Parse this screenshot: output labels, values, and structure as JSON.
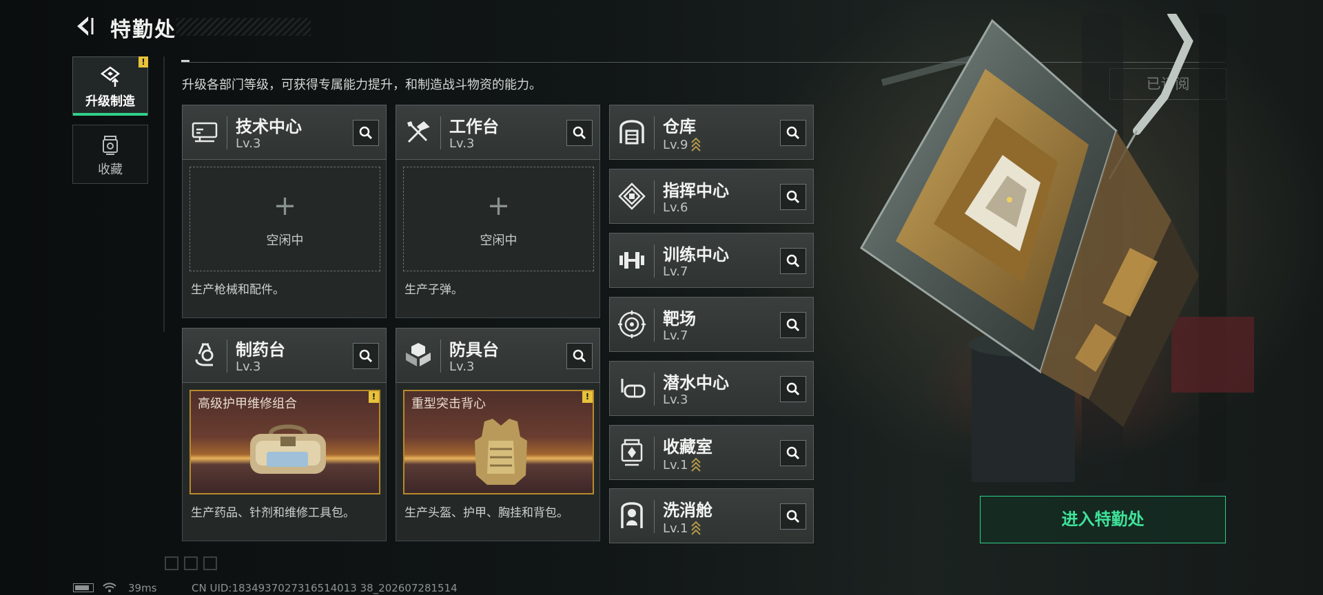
{
  "header": {
    "title": "特勤处",
    "back_icon": "back-arrow-icon"
  },
  "sidebar": {
    "tabs": [
      {
        "label": "升级制造",
        "icon": "upgrade-craft-icon",
        "active": true,
        "alert": "!"
      },
      {
        "label": "收藏",
        "icon": "collection-icon",
        "active": false
      }
    ]
  },
  "description": "升级各部门等级，可获得专属能力提升，和制造战斗物资的能力。",
  "subscribed_label": "已订阅",
  "stations": [
    {
      "name": "技术中心",
      "level": "Lv.3",
      "icon": "tech-center-icon",
      "slot": {
        "type": "idle",
        "plus": "+",
        "text": "空闲中"
      },
      "desc": "生产枪械和配件。"
    },
    {
      "name": "工作台",
      "level": "Lv.3",
      "icon": "workbench-icon",
      "slot": {
        "type": "idle",
        "plus": "+",
        "text": "空闲中"
      },
      "desc": "生产子弹。"
    },
    {
      "name": "制药台",
      "level": "Lv.3",
      "icon": "pharmacy-icon",
      "slot": {
        "type": "item",
        "item_name": "高级护甲维修组合",
        "alert": "!"
      },
      "desc": "生产药品、针剂和维修工具包。"
    },
    {
      "name": "防具台",
      "level": "Lv.3",
      "icon": "armor-bench-icon",
      "slot": {
        "type": "item",
        "item_name": "重型突击背心",
        "alert": "!"
      },
      "desc": "生产头盔、护甲、胸挂和背包。"
    }
  ],
  "side_stations": [
    {
      "name": "仓库",
      "level": "Lv.9",
      "upgradable": true,
      "icon": "warehouse-icon"
    },
    {
      "name": "指挥中心",
      "level": "Lv.6",
      "upgradable": false,
      "icon": "command-center-icon"
    },
    {
      "name": "训练中心",
      "level": "Lv.7",
      "upgradable": false,
      "icon": "training-center-icon"
    },
    {
      "name": "靶场",
      "level": "Lv.7",
      "upgradable": false,
      "icon": "shooting-range-icon"
    },
    {
      "name": "潜水中心",
      "level": "Lv.3",
      "upgradable": false,
      "icon": "diving-center-icon"
    },
    {
      "name": "收藏室",
      "level": "Lv.1",
      "upgradable": true,
      "icon": "collection-room-icon"
    },
    {
      "name": "洗消舱",
      "level": "Lv.1",
      "upgradable": true,
      "icon": "decon-chamber-icon"
    }
  ],
  "enter_button": "进入特勤处",
  "status": {
    "ping": "39ms",
    "uid": "CN UID:1834937027316514013 38_202607281514"
  },
  "colors": {
    "accent": "#2fd18a",
    "alert": "#e8c23a",
    "upgrade_chevron": "#b89a4a"
  }
}
